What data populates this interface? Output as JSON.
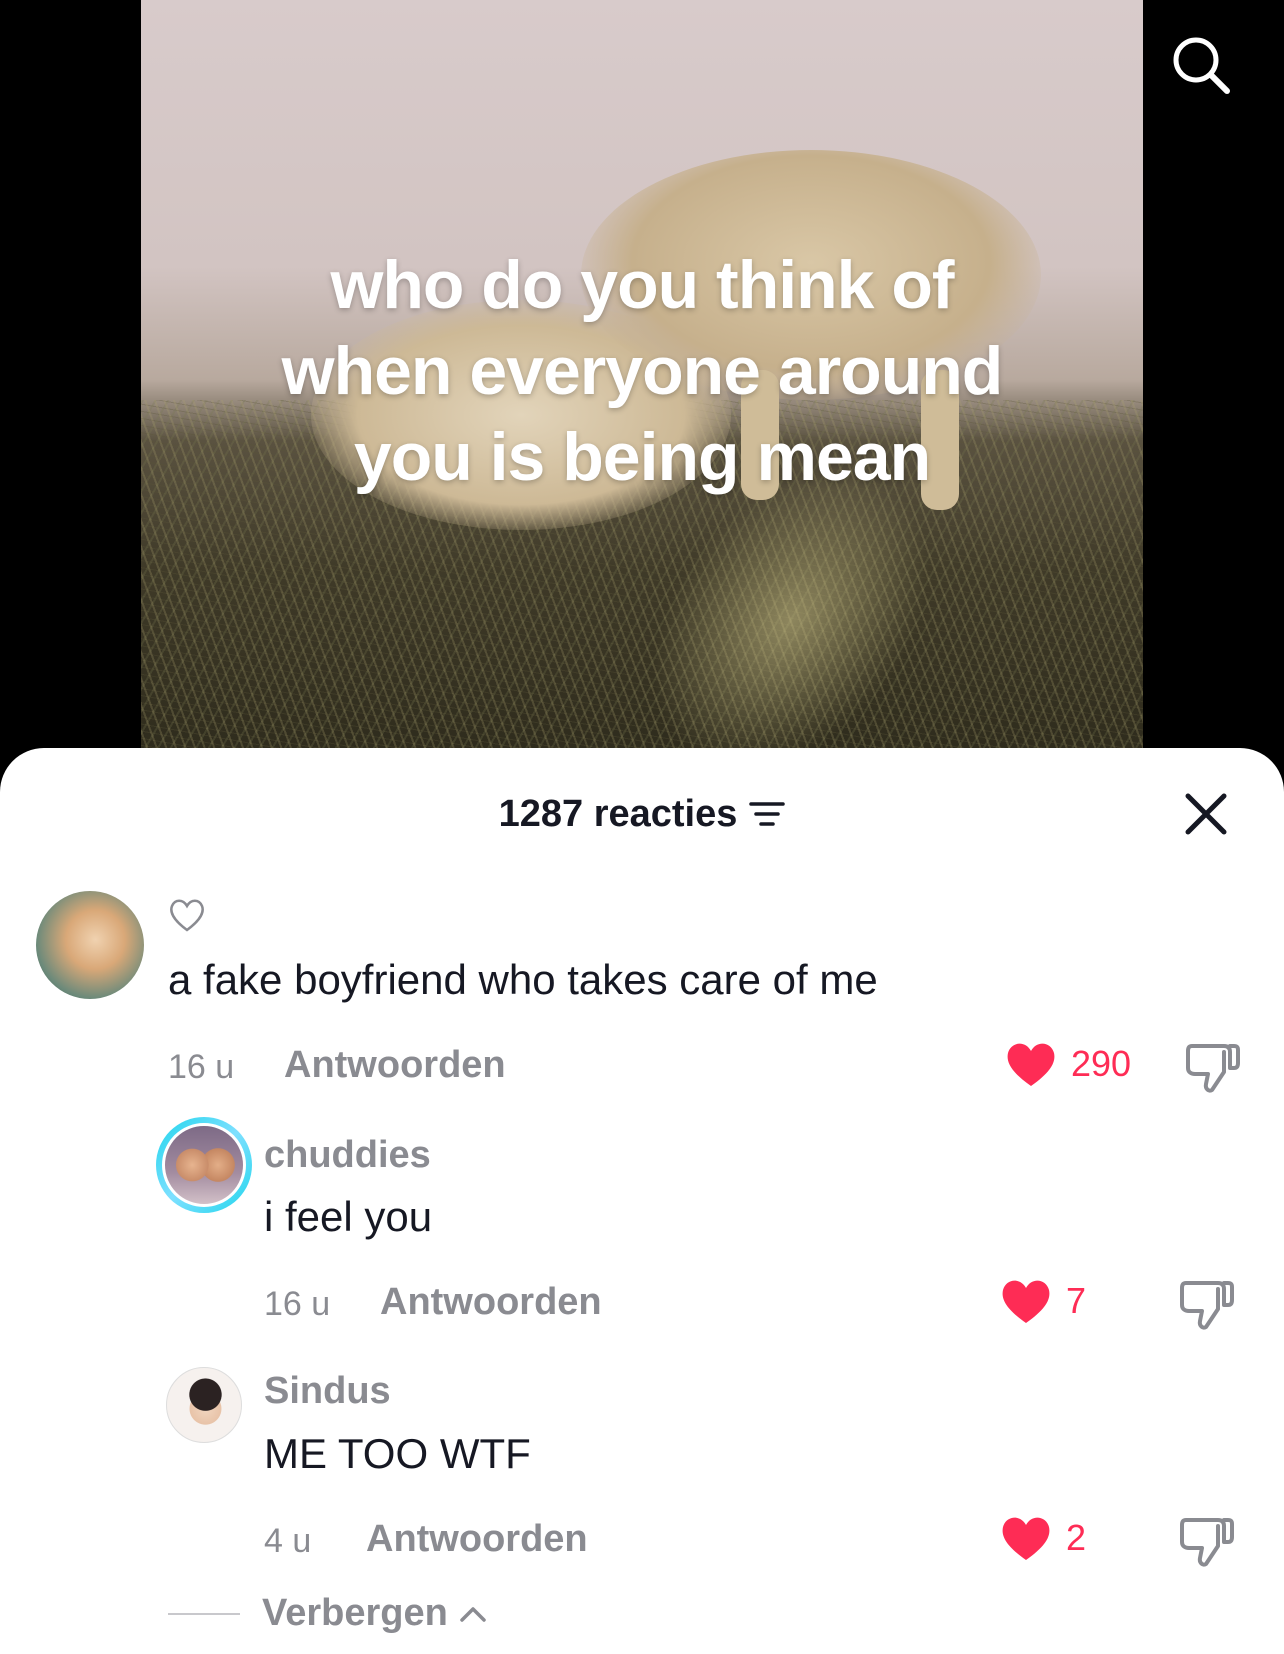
{
  "video": {
    "overlay_lines": [
      "who do you think of",
      "when everyone around",
      "you is being mean"
    ]
  },
  "sheet": {
    "comment_count_label": "1287 reacties"
  },
  "comments": [
    {
      "username": "",
      "text": "a fake boyfriend who takes care of me",
      "time": "16 u",
      "reply_label": "Antwoorden",
      "likes": "290",
      "liked": true
    },
    {
      "username": "chuddies",
      "text": "i feel you",
      "time": "16 u",
      "reply_label": "Antwoorden",
      "likes": "7",
      "liked": true
    },
    {
      "username": "Sindus",
      "text": "ME TOO WTF",
      "time": "4 u",
      "reply_label": "Antwoorden",
      "likes": "2",
      "liked": true
    }
  ],
  "hide_replies_label": "Verbergen",
  "icons": {
    "search": "search-icon",
    "close": "close-icon",
    "filter": "filter-icon",
    "heart": "heart-icon",
    "dislike": "thumbs-down-icon",
    "chevron": "chevron-up-icon"
  },
  "colors": {
    "like_red": "#fe2c55",
    "muted_gray": "#8a8b91",
    "text_dark": "#161823"
  }
}
